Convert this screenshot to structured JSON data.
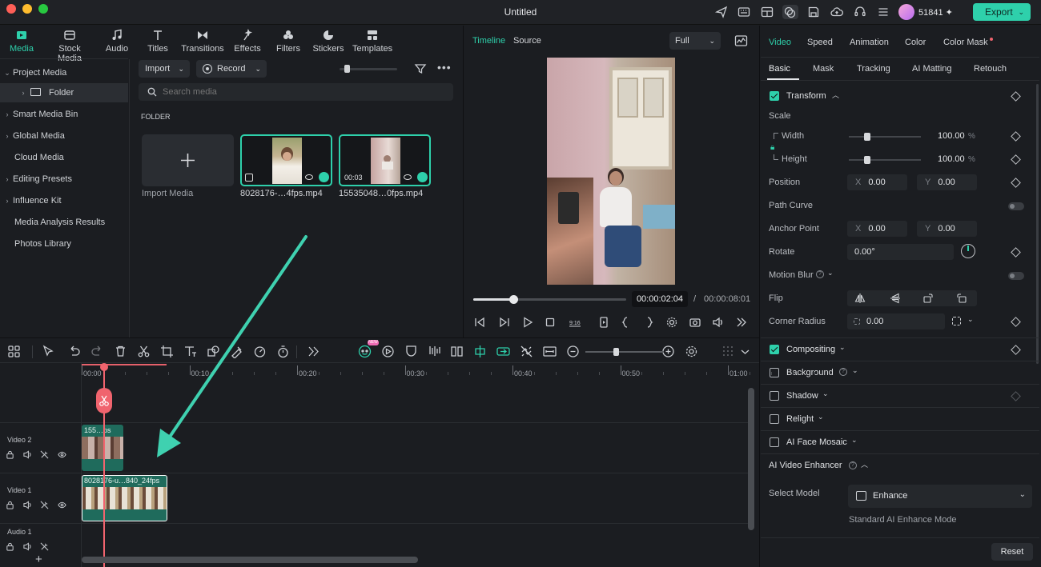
{
  "window": {
    "title": "Untitled"
  },
  "topbar": {
    "credits": "51841",
    "export_label": "Export"
  },
  "media_tabs": [
    {
      "label": "Media",
      "icon": "media-icon",
      "active": true
    },
    {
      "label": "Stock Media",
      "icon": "stock-media-icon"
    },
    {
      "label": "Audio",
      "icon": "audio-icon"
    },
    {
      "label": "Titles",
      "icon": "titles-icon"
    },
    {
      "label": "Transitions",
      "icon": "transitions-icon"
    },
    {
      "label": "Effects",
      "icon": "effects-icon"
    },
    {
      "label": "Filters",
      "icon": "filters-icon"
    },
    {
      "label": "Stickers",
      "icon": "stickers-icon"
    },
    {
      "label": "Templates",
      "icon": "templates-icon"
    }
  ],
  "sidebar": {
    "items": [
      {
        "label": "Project Media",
        "chevron": "down"
      },
      {
        "label": "Folder",
        "chevron": "right",
        "selected": true
      },
      {
        "label": "Smart Media Bin",
        "chevron": "right"
      },
      {
        "label": "Global Media",
        "chevron": "right"
      },
      {
        "label": "Cloud Media",
        "chevron": ""
      },
      {
        "label": "Editing Presets",
        "chevron": "right"
      },
      {
        "label": "Influence Kit",
        "chevron": "right"
      },
      {
        "label": "Media Analysis Results",
        "chevron": ""
      },
      {
        "label": "Photos Library",
        "chevron": ""
      }
    ]
  },
  "media": {
    "import_label": "Import",
    "record_label": "Record",
    "search_placeholder": "Search media",
    "folder_heading": "FOLDER",
    "import_media_label": "Import Media",
    "items": [
      {
        "name": "8028176-…4fps.mp4",
        "duration": ""
      },
      {
        "name": "15535048…0fps.mp4",
        "duration": "00:03"
      }
    ]
  },
  "preview": {
    "tab_timeline": "Timeline",
    "tab_source": "Source",
    "quality": "Full",
    "current_time": "00:00:02:04",
    "separator": "/",
    "total_time": "00:00:08:01",
    "progress": 0.26
  },
  "properties": {
    "tabs": [
      {
        "label": "Video",
        "active": true
      },
      {
        "label": "Speed"
      },
      {
        "label": "Animation"
      },
      {
        "label": "Color"
      },
      {
        "label": "Color Mask",
        "dot": true
      }
    ],
    "subtabs": [
      {
        "label": "Basic",
        "active": true
      },
      {
        "label": "Mask"
      },
      {
        "label": "Tracking"
      },
      {
        "label": "AI Matting"
      },
      {
        "label": "Retouch"
      }
    ],
    "transform": {
      "label": "Transform",
      "scale_label": "Scale",
      "width_label": "Width",
      "width_value": "100.00",
      "height_label": "Height",
      "height_value": "100.00",
      "percent": "%",
      "position_label": "Position",
      "pos_x": "0.00",
      "pos_y": "0.00",
      "axis_x": "X",
      "axis_y": "Y",
      "path_curve_label": "Path Curve",
      "anchor_label": "Anchor Point",
      "anchor_x": "0.00",
      "anchor_y": "0.00",
      "rotate_label": "Rotate",
      "rotate_value": "0.00°",
      "motion_blur_label": "Motion Blur",
      "flip_label": "Flip",
      "corner_radius_label": "Corner Radius",
      "corner_radius_value": "0.00"
    },
    "compositing_label": "Compositing",
    "background_label": "Background",
    "shadow_label": "Shadow",
    "relight_label": "Relight",
    "ai_face_mosaic_label": "AI Face Mosaic",
    "ai_video_enhancer_label": "AI Video Enhancer",
    "select_model_label": "Select Model",
    "model_value": "Enhance",
    "model_desc": "Standard AI Enhance Mode",
    "reset_label": "Reset"
  },
  "timeline": {
    "ruler": [
      "00:00",
      "00:10",
      "00:20",
      "00:30",
      "00:40",
      "00:50",
      "01:00"
    ],
    "tracks": [
      {
        "name": "Video 2",
        "clip_label": "155…ps"
      },
      {
        "name": "Video 1",
        "clip_label": "8028176-u…840_24fps"
      },
      {
        "name": "Audio 1",
        "clip_label": ""
      }
    ],
    "new_badge": "NEW",
    "add_track": "+"
  },
  "colors": {
    "accent": "#2ed0ab",
    "playhead": "#f0646e",
    "clip": "#1f6b5c"
  }
}
